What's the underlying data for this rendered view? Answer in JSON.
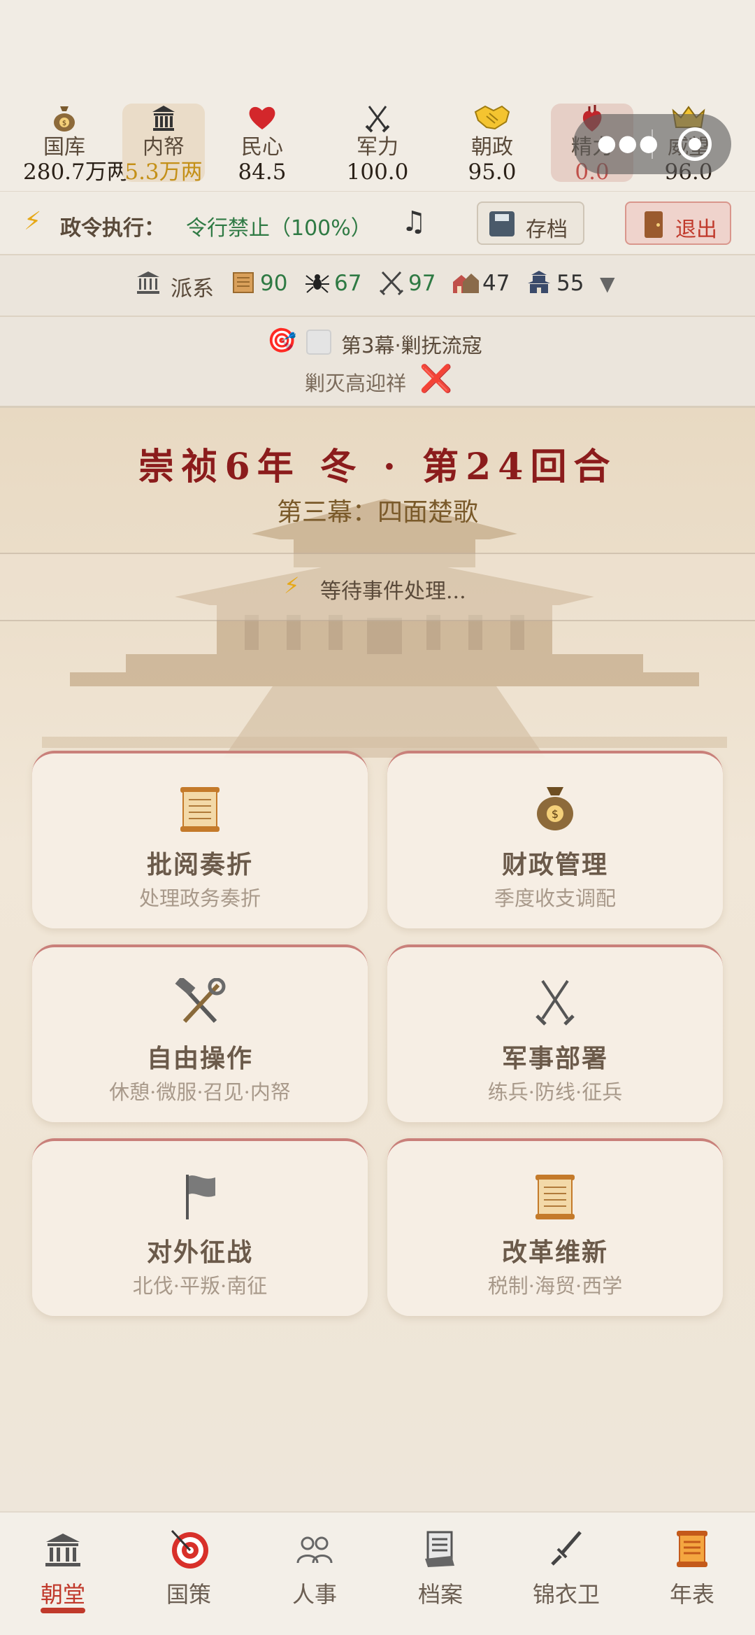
{
  "stats": [
    {
      "icon": "money-bag-icon",
      "label": "国库",
      "value": "280.7万两",
      "state": "normal"
    },
    {
      "icon": "treasury-building-icon",
      "label": "内帑",
      "value": "5.3万两",
      "state": "active"
    },
    {
      "icon": "heart-icon",
      "label": "民心",
      "value": "84.5",
      "state": "normal"
    },
    {
      "icon": "crossed-swords-icon",
      "label": "军力",
      "value": "100.0",
      "state": "normal"
    },
    {
      "icon": "handshake-icon",
      "label": "朝政",
      "value": "95.0",
      "state": "normal"
    },
    {
      "icon": "anatomical-heart-icon",
      "label": "精力",
      "value": "0.0",
      "state": "alert"
    },
    {
      "icon": "crown-icon",
      "label": "威望",
      "value": "96.0",
      "state": "normal"
    }
  ],
  "decree": {
    "label": "政令执行：",
    "value": "令行禁止（100%）",
    "save_label": "存档",
    "exit_label": "退出"
  },
  "faction": {
    "label": "派系",
    "items": [
      {
        "icon": "scroll-icon",
        "value": "90",
        "color": "#2f7a44"
      },
      {
        "icon": "spider-icon",
        "value": "67",
        "color": "#2f7a44"
      },
      {
        "icon": "crossed-swords-icon",
        "value": "97",
        "color": "#2f7a44"
      },
      {
        "icon": "houses-icon",
        "value": "47",
        "color": "#333333"
      },
      {
        "icon": "castle-icon",
        "value": "55",
        "color": "#333333"
      }
    ],
    "caret": "▼"
  },
  "quest": {
    "title": "第3幕·剿抚流寇",
    "goal": "剿灭高迎祥",
    "status": "❌"
  },
  "turn": {
    "title": "崇祯6年 冬 · 第24回合",
    "act": "第三幕：四面楚歌",
    "waiting": "等待事件处理..."
  },
  "cards": [
    {
      "icon": "scroll-icon",
      "title": "批阅奏折",
      "subtitle": "处理政务奏折"
    },
    {
      "icon": "money-bag-icon",
      "title": "财政管理",
      "subtitle": "季度收支调配"
    },
    {
      "icon": "hammer-wrench-icon",
      "title": "自由操作",
      "subtitle": "休憩·微服·召见·内帑"
    },
    {
      "icon": "crossed-swords-icon",
      "title": "军事部署",
      "subtitle": "练兵·防线·征兵"
    },
    {
      "icon": "flag-icon",
      "title": "对外征战",
      "subtitle": "北伐·平叛·南征"
    },
    {
      "icon": "scroll-icon",
      "title": "改革维新",
      "subtitle": "税制·海贸·西学"
    }
  ],
  "nav": [
    {
      "icon": "classical-building-icon",
      "label": "朝堂",
      "active": true
    },
    {
      "icon": "target-icon",
      "label": "国策",
      "active": false
    },
    {
      "icon": "people-icon",
      "label": "人事",
      "active": false
    },
    {
      "icon": "documents-icon",
      "label": "档案",
      "active": false
    },
    {
      "icon": "dagger-icon",
      "label": "锦衣卫",
      "active": false
    },
    {
      "icon": "scroll-icon",
      "label": "年表",
      "active": false
    }
  ],
  "colors": {
    "accent": "#c0392b",
    "title_red": "#8b1c1c",
    "positive_green": "#2f7a44",
    "gold": "#c49018"
  }
}
